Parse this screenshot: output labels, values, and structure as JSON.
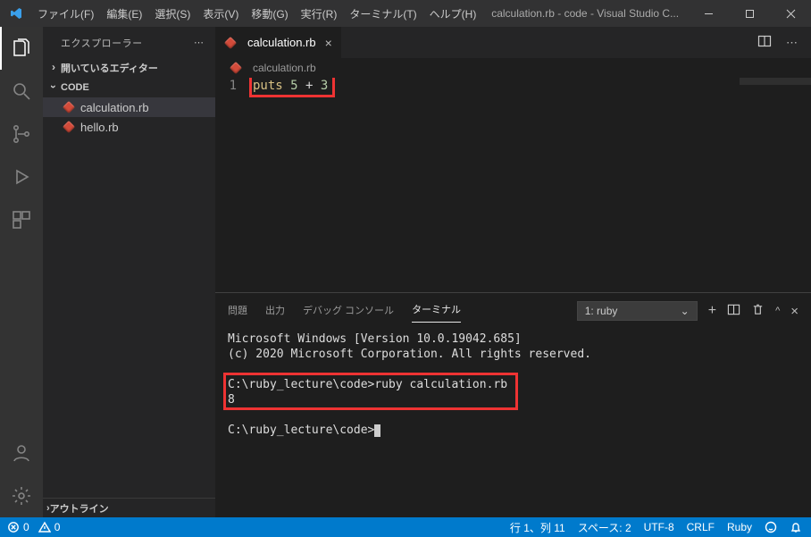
{
  "title": "calculation.rb - code - Visual Studio C...",
  "menu": {
    "file": "ファイル(F)",
    "edit": "編集(E)",
    "select": "選択(S)",
    "view": "表示(V)",
    "go": "移動(G)",
    "run": "実行(R)",
    "terminal": "ターミナル(T)",
    "help": "ヘルプ(H)"
  },
  "sidebar": {
    "title": "エクスプローラー",
    "open_editors": "開いているエディター",
    "folder": "CODE",
    "files": [
      "calculation.rb",
      "hello.rb"
    ],
    "outline": "アウトライン"
  },
  "editor": {
    "tab": "calculation.rb",
    "breadcrumb": "calculation.rb",
    "line_number": "1",
    "code": {
      "keyword": "puts",
      "n1": "5",
      "op": "+",
      "n2": "3"
    }
  },
  "panel": {
    "tabs": {
      "problems": "問題",
      "output": "出力",
      "debug": "デバッグ コンソール",
      "terminal": "ターミナル"
    },
    "term_select": "1: ruby",
    "lines": {
      "l1": "Microsoft Windows [Version 10.0.19042.685]",
      "l2": "(c) 2020 Microsoft Corporation. All rights reserved.",
      "l3": "C:\\ruby_lecture\\code>ruby calculation.rb",
      "l4": "8",
      "l5": "C:\\ruby_lecture\\code>"
    }
  },
  "status": {
    "errors": "0",
    "warnings": "0",
    "ln_col": "行 1、列 11",
    "spaces": "スペース: 2",
    "encoding": "UTF-8",
    "eol": "CRLF",
    "lang": "Ruby"
  }
}
